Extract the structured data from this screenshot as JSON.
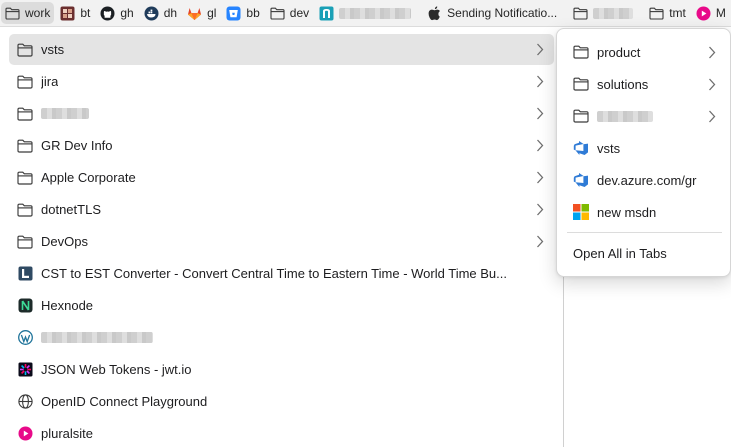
{
  "bookmarks_bar": {
    "items": [
      {
        "label": "work"
      },
      {
        "label": "bt"
      },
      {
        "label": "gh"
      },
      {
        "label": "dh"
      },
      {
        "label": "gl"
      },
      {
        "label": "bb"
      },
      {
        "label": "dev"
      },
      {
        "label": ""
      },
      {
        "label": "Sending Notificatio..."
      },
      {
        "label": ""
      },
      {
        "label": "tmt"
      },
      {
        "label": "M"
      }
    ]
  },
  "menu": {
    "items": [
      {
        "label": "vsts",
        "icon": "folder-icon",
        "submenu": true
      },
      {
        "label": "jira",
        "icon": "folder-icon",
        "submenu": true
      },
      {
        "label": "",
        "icon": "folder-icon",
        "submenu": true
      },
      {
        "label": "GR Dev Info",
        "icon": "folder-icon",
        "submenu": true
      },
      {
        "label": "Apple Corporate",
        "icon": "folder-icon",
        "submenu": true
      },
      {
        "label": "dotnetTLS",
        "icon": "folder-icon",
        "submenu": true
      },
      {
        "label": "DevOps",
        "icon": "folder-icon",
        "submenu": true
      },
      {
        "label": "CST to EST Converter - Convert Central Time to Eastern Time - World Time Bu...",
        "icon": "time-converter-icon"
      },
      {
        "label": "Hexnode",
        "icon": "hexnode-icon"
      },
      {
        "label": "",
        "icon": "wordpress-icon"
      },
      {
        "label": "JSON Web Tokens - jwt.io",
        "icon": "jwt-icon"
      },
      {
        "label": "OpenID Connect Playground",
        "icon": "globe-icon"
      },
      {
        "label": "pluralsite",
        "icon": "pluralsight-icon"
      }
    ]
  },
  "submenu": {
    "items": [
      {
        "label": "product",
        "icon": "folder-icon",
        "submenu": true
      },
      {
        "label": "solutions",
        "icon": "folder-icon",
        "submenu": true
      },
      {
        "label": "",
        "icon": "folder-icon",
        "submenu": true
      },
      {
        "label": "vsts",
        "icon": "azure-devops-icon"
      },
      {
        "label": "dev.azure.com/gr",
        "icon": "azure-devops-icon"
      },
      {
        "label": "new msdn",
        "icon": "microsoft-icon"
      }
    ],
    "open_all": "Open All in Tabs"
  }
}
